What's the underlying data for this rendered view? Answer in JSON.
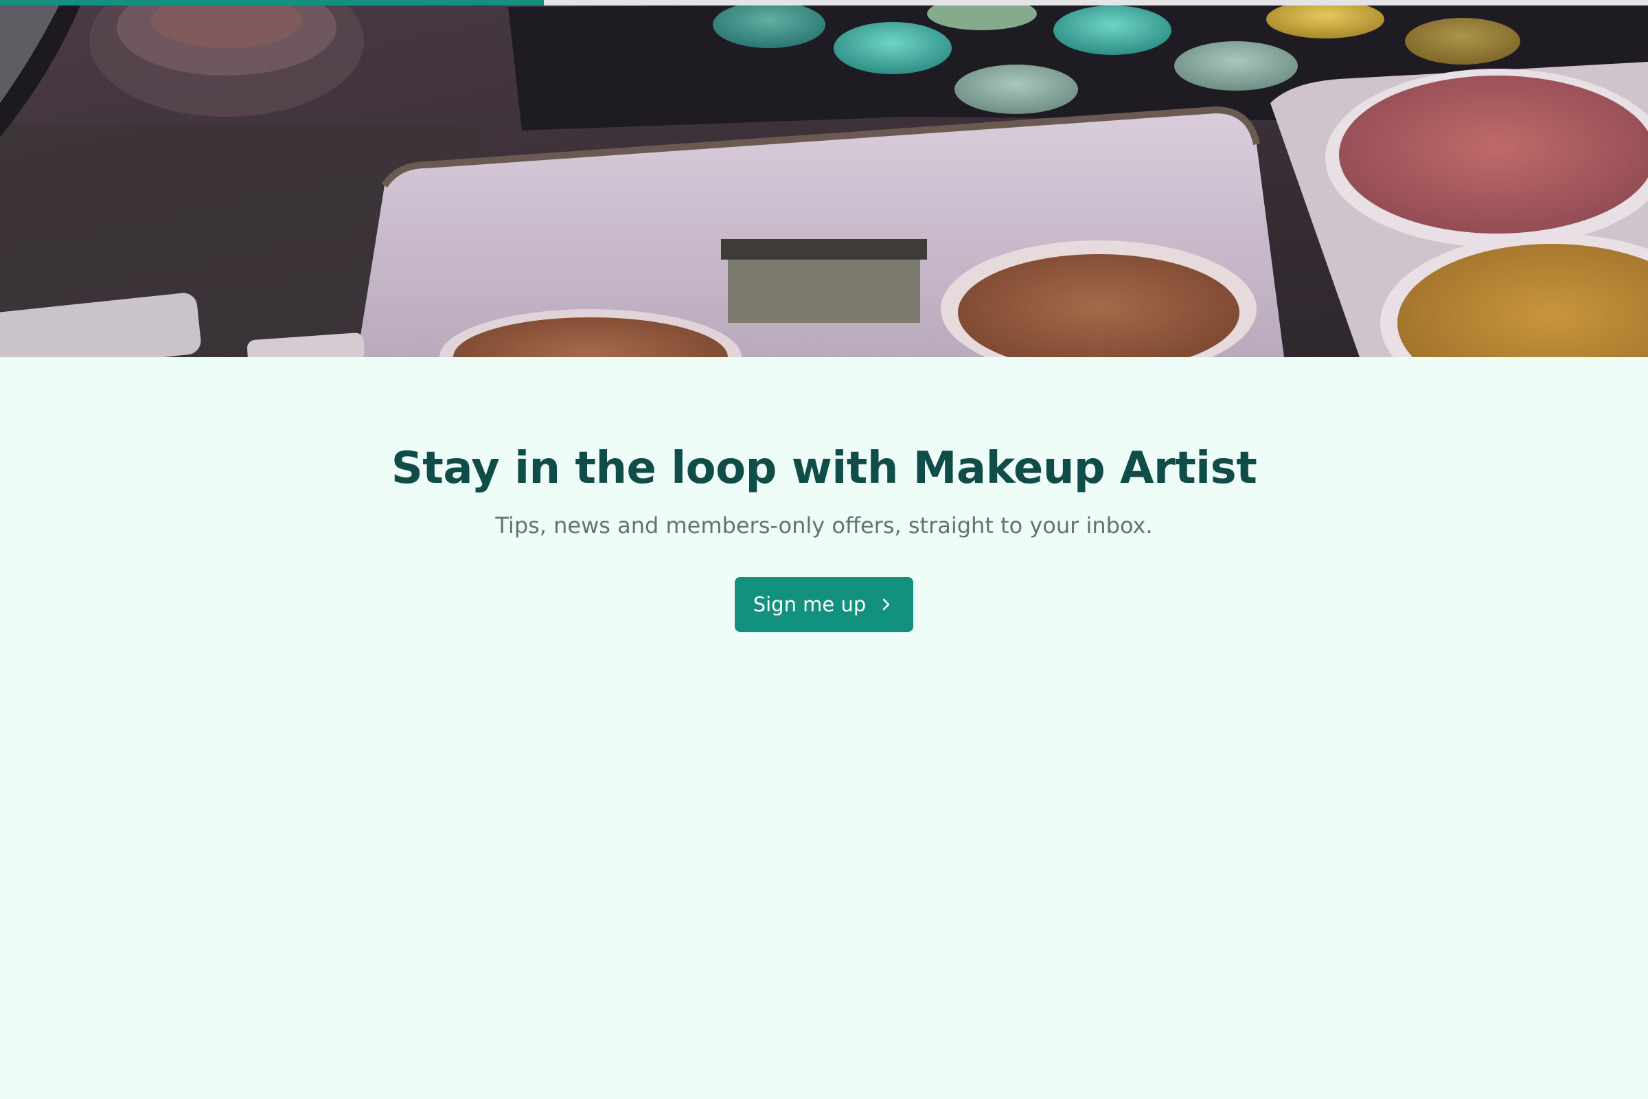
{
  "progress": {
    "value": 0.33,
    "color": "#13917f"
  },
  "hero": {
    "image_subject": "makeup palette with pots of powder colours"
  },
  "signup": {
    "headline": "Stay in the loop with Makeup Artist",
    "subline": "Tips, news and members-only offers, straight to your inbox.",
    "button_label": "Sign me up",
    "button_icon": "chevron-right-icon"
  },
  "colors": {
    "accent": "#13917f",
    "heading": "#114d48",
    "muted_text": "#5d7573",
    "background": "#effdf9"
  }
}
